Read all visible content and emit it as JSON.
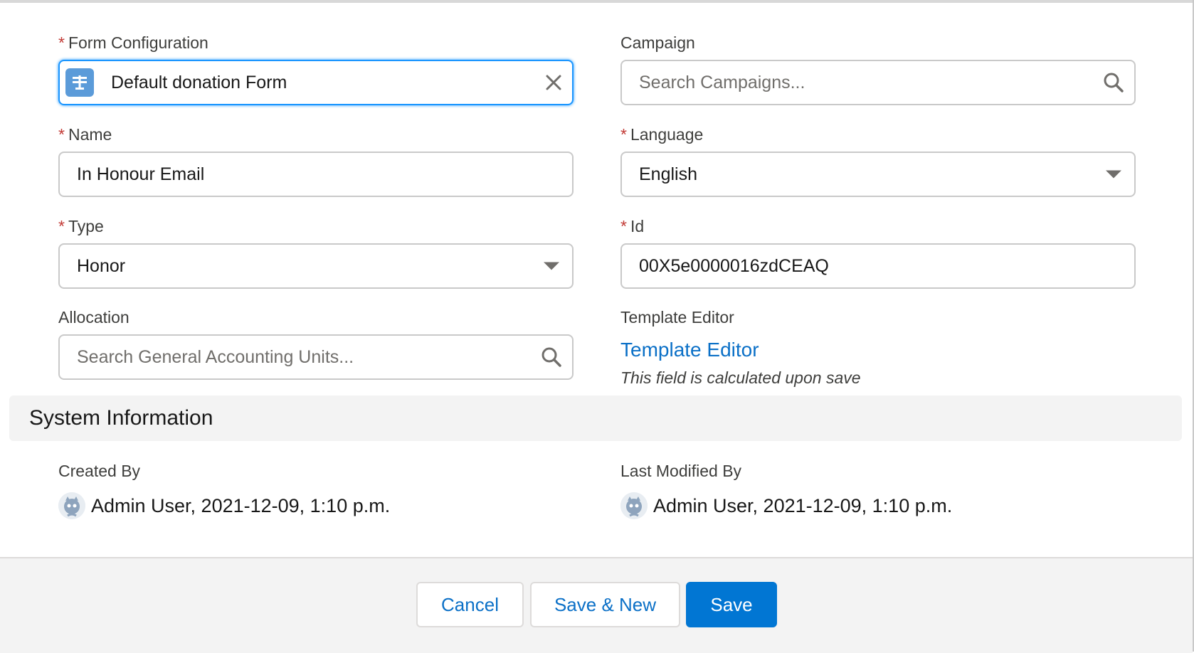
{
  "fields": {
    "form_configuration": {
      "label": "Form Configuration",
      "value": "Default donation Form",
      "required": "*"
    },
    "campaign": {
      "label": "Campaign",
      "placeholder": "Search Campaigns..."
    },
    "name": {
      "label": "Name",
      "value": "In Honour Email",
      "required": "*"
    },
    "language": {
      "label": "Language",
      "value": "English",
      "required": "*"
    },
    "type": {
      "label": "Type",
      "value": "Honor",
      "required": "*"
    },
    "id": {
      "label": "Id",
      "value": "00X5e0000016zdCEAQ",
      "required": "*"
    },
    "allocation": {
      "label": "Allocation",
      "placeholder": "Search General Accounting Units..."
    },
    "template_editor": {
      "label": "Template Editor",
      "link": "Template Editor",
      "help": "This field is calculated upon save"
    }
  },
  "system_information": {
    "title": "System Information",
    "created_by": {
      "label": "Created By",
      "value": "Admin User, 2021-12-09, 1:10 p.m."
    },
    "last_modified_by": {
      "label": "Last Modified By",
      "value": "Admin User, 2021-12-09, 1:10 p.m."
    }
  },
  "footer": {
    "cancel": "Cancel",
    "save_new": "Save & New",
    "save": "Save"
  },
  "colors": {
    "brand": "#0176d3",
    "link": "#0b70c7",
    "required": "#c23934",
    "focus": "#1b96ff"
  },
  "icons": {
    "form_configuration": "form-record-icon",
    "clear": "close-icon",
    "search": "search-icon",
    "dropdown": "chevron-down-icon",
    "avatar": "user-avatar-icon"
  }
}
